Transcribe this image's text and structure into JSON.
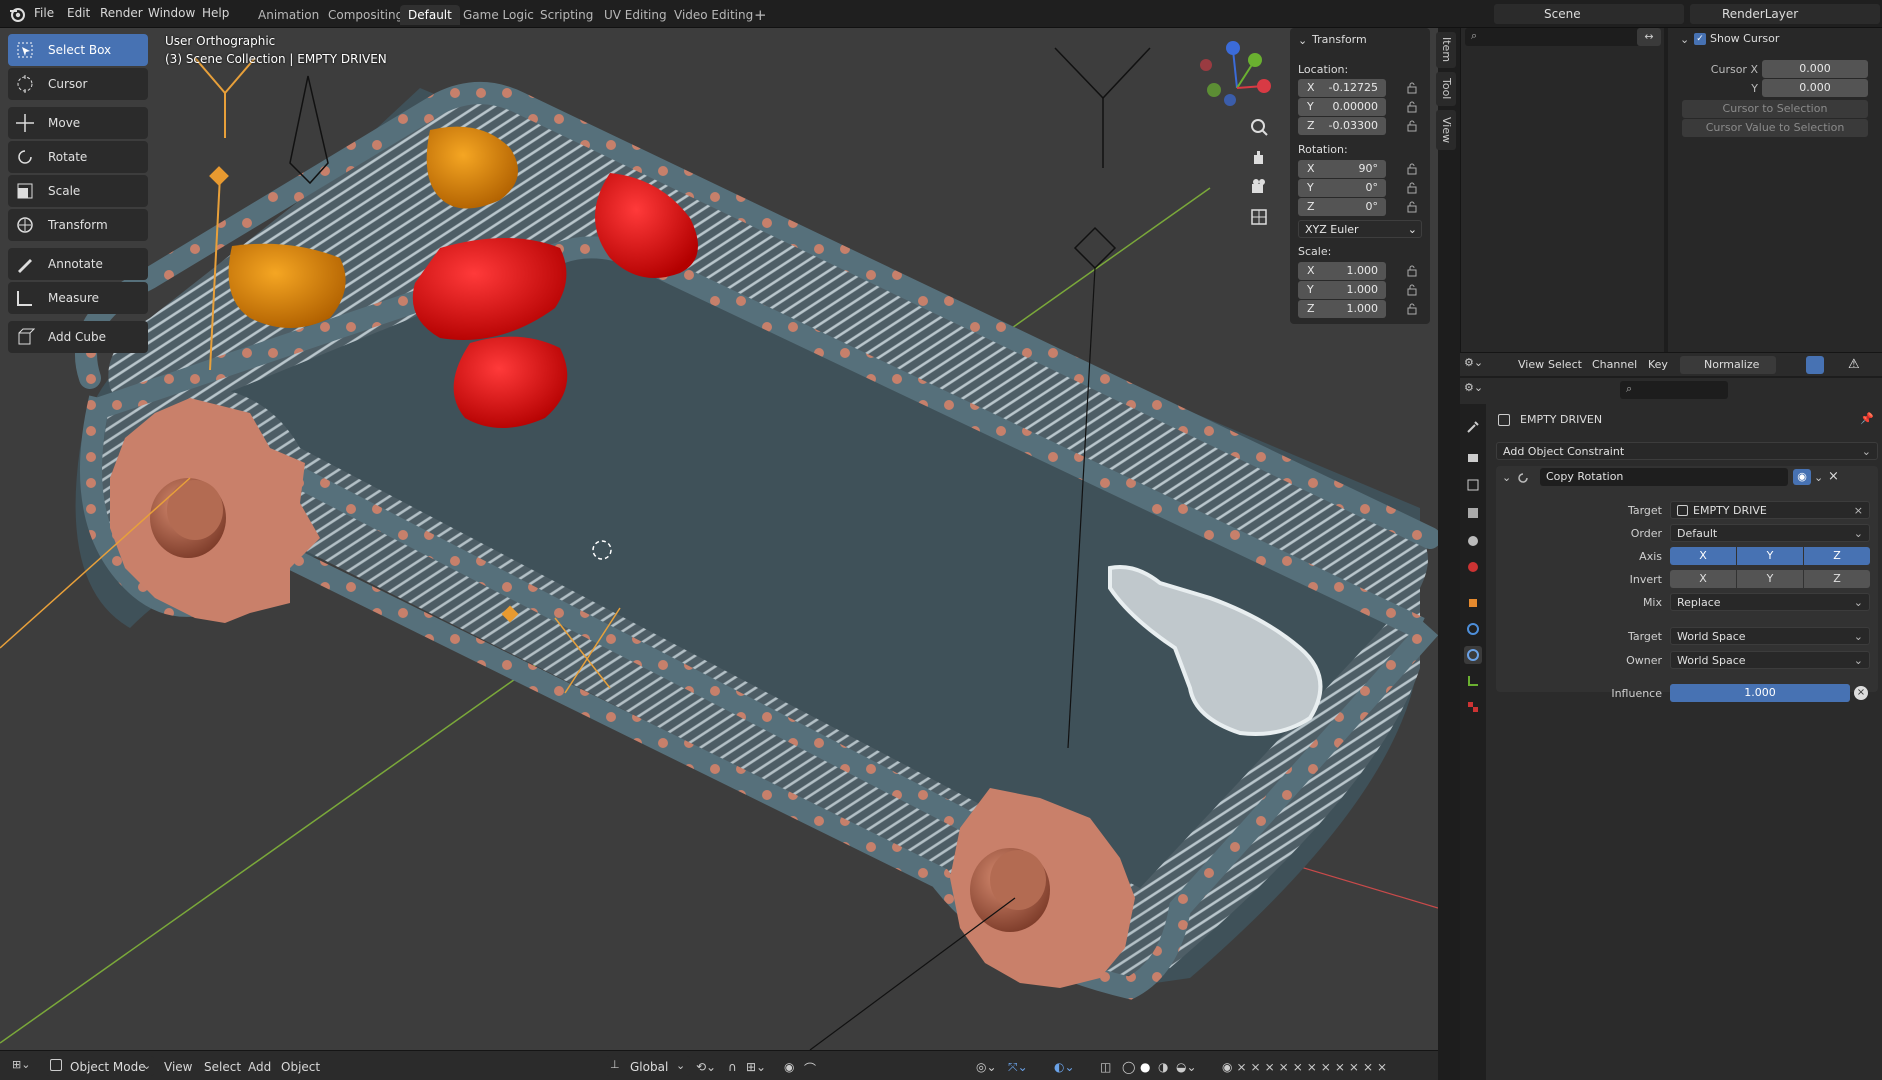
{
  "menu": {
    "file": "File",
    "edit": "Edit",
    "render": "Render",
    "window": "Window",
    "help": "Help"
  },
  "workspaces": [
    "Animation",
    "Compositing",
    "Default",
    "Game Logic",
    "Scripting",
    "UV Editing",
    "Video Editing"
  ],
  "active_workspace": "Default",
  "scene_name": "Scene",
  "render_layer": "RenderLayer",
  "tools": [
    "Select Box",
    "Cursor",
    "Move",
    "Rotate",
    "Scale",
    "Transform",
    "Annotate",
    "Measure",
    "Add Cube"
  ],
  "viewport": {
    "view_name": "User Orthographic",
    "collection_info": "(3) Scene Collection | EMPTY DRIVEN"
  },
  "transform": {
    "title": "Transform",
    "location_label": "Location:",
    "location": [
      {
        "axis": "X",
        "value": "-0.12725"
      },
      {
        "axis": "Y",
        "value": "0.00000"
      },
      {
        "axis": "Z",
        "value": "-0.03300"
      }
    ],
    "rotation_label": "Rotation:",
    "rotation": [
      {
        "axis": "X",
        "value": "90°"
      },
      {
        "axis": "Y",
        "value": "0°"
      },
      {
        "axis": "Z",
        "value": "0°"
      }
    ],
    "rotation_mode": "XYZ Euler",
    "scale_label": "Scale:",
    "scale": [
      {
        "axis": "X",
        "value": "1.000"
      },
      {
        "axis": "Y",
        "value": "1.000"
      },
      {
        "axis": "Z",
        "value": "1.000"
      }
    ]
  },
  "sidebar_tabs": [
    "Item",
    "Tool",
    "View"
  ],
  "cursor_panel": {
    "title": "Show Cursor",
    "cursor_x_label": "Cursor X",
    "cursor_y_label": "Y",
    "cursor_x": "0.000",
    "cursor_y": "0.000",
    "to_selection": "Cursor to Selection",
    "value_to_selection": "Cursor Value to Selection"
  },
  "graph_header": {
    "view": "View",
    "select": "Select",
    "channel": "Channel",
    "key": "Key",
    "normalize": "Normalize"
  },
  "properties": {
    "object_name": "EMPTY DRIVEN",
    "add_constraint": "Add Object Constraint",
    "constraint_name": "Copy Rotation",
    "target_label": "Target",
    "target_value": "EMPTY DRIVE",
    "order_label": "Order",
    "order_value": "Default",
    "axis_label": "Axis",
    "invert_label": "Invert",
    "axes": [
      "X",
      "Y",
      "Z"
    ],
    "mix_label": "Mix",
    "mix_value": "Replace",
    "target_space_label": "Target",
    "target_space": "World Space",
    "owner_space_label": "Owner",
    "owner_space": "World Space",
    "influence_label": "Influence",
    "influence": "1.000",
    "influence_fraction": 1.0
  },
  "bottom": {
    "mode": "Object Mode",
    "view": "View",
    "select": "Select",
    "add": "Add",
    "object": "Object",
    "orientation": "Global"
  },
  "colors": {
    "accent": "#4772b3",
    "viewport_bg": "#3d3d3d",
    "belt": "#5f7781",
    "sprocket": "#c9806a",
    "red": "#e11010",
    "orange": "#e08a10"
  }
}
